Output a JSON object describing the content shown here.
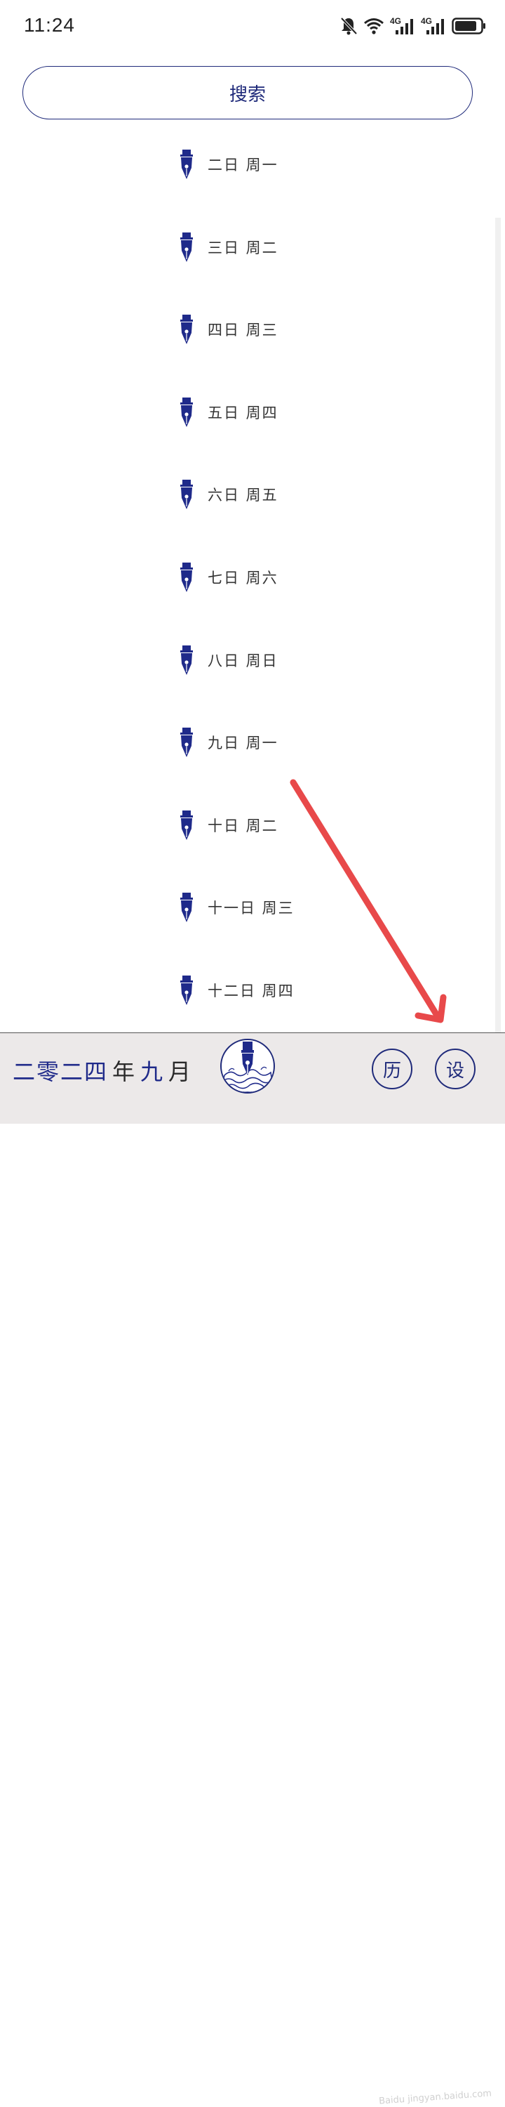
{
  "status_bar": {
    "time": "11:24",
    "icons": [
      "bell-mute-icon",
      "wifi-icon",
      "4g-signal-icon",
      "4g-signal-icon",
      "battery-icon"
    ],
    "network_label_1": "4G",
    "network_label_2": "4G"
  },
  "search": {
    "label": "搜索"
  },
  "entries": [
    {
      "label": "二日 周一",
      "icon": "fountain-pen-nib-icon"
    },
    {
      "label": "三日 周二",
      "icon": "fountain-pen-nib-icon"
    },
    {
      "label": "四日 周三",
      "icon": "fountain-pen-nib-icon"
    },
    {
      "label": "五日 周四",
      "icon": "fountain-pen-nib-icon"
    },
    {
      "label": "六日 周五",
      "icon": "fountain-pen-nib-icon"
    },
    {
      "label": "七日 周六",
      "icon": "fountain-pen-nib-icon"
    },
    {
      "label": "八日 周日",
      "icon": "fountain-pen-nib-icon"
    },
    {
      "label": "九日 周一",
      "icon": "fountain-pen-nib-icon"
    },
    {
      "label": "十日 周二",
      "icon": "fountain-pen-nib-icon"
    },
    {
      "label": "十一日 周三",
      "icon": "fountain-pen-nib-icon"
    },
    {
      "label": "十二日 周四",
      "icon": "fountain-pen-nib-icon"
    }
  ],
  "bottom_bar": {
    "year_label": "二零二四",
    "year_unit": "年",
    "month_label": "九",
    "month_unit": "月",
    "history_button_label": "历",
    "settings_button_label": "设",
    "center_icon": "pen-wave-logo-icon"
  },
  "watermark": {
    "text": "Baidu jingyan.baidu.com"
  },
  "colors": {
    "accent": "#1f2a8a",
    "annotation_arrow": "#e8494a",
    "bottom_bar_bg": "#ece9e9"
  }
}
